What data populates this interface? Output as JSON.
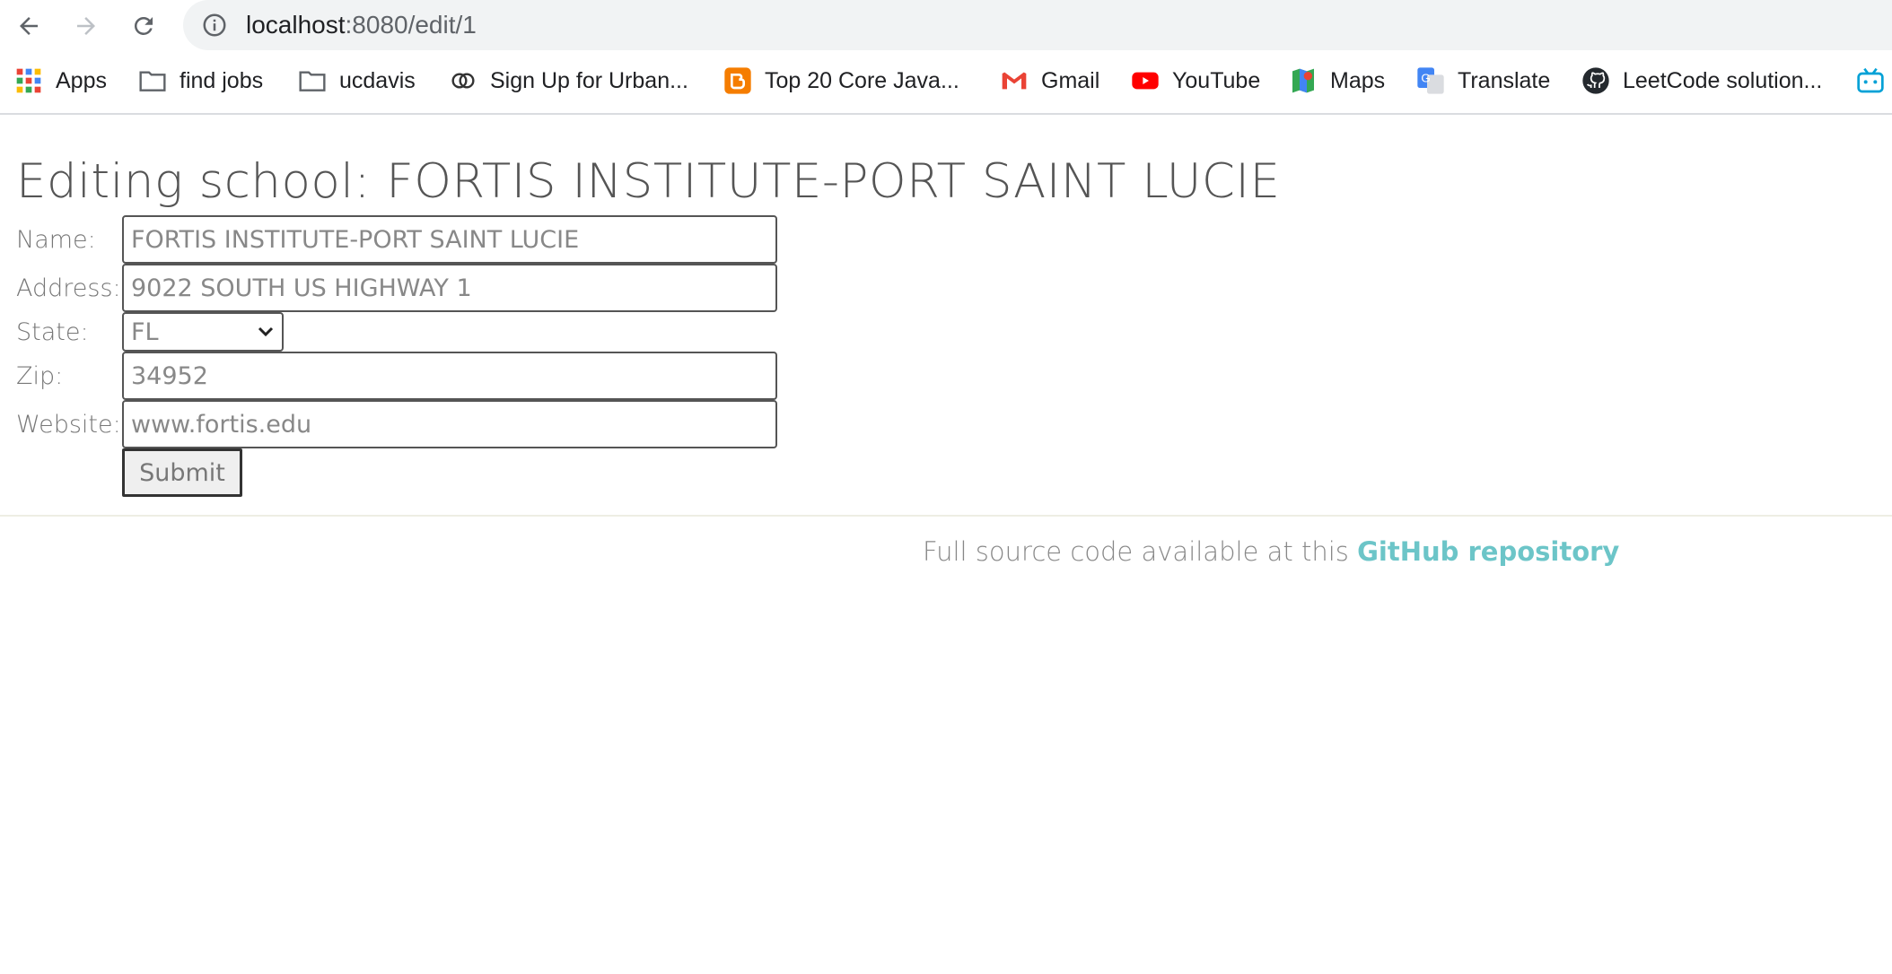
{
  "browser": {
    "url_host": "localhost",
    "url_path": ":8080/edit/1",
    "bookmarks": [
      {
        "label": "Apps",
        "icon": "apps-grid-icon"
      },
      {
        "label": "find jobs",
        "icon": "folder-icon"
      },
      {
        "label": "ucdavis",
        "icon": "folder-icon"
      },
      {
        "label": "Sign Up for Urban...",
        "icon": "rings-icon"
      },
      {
        "label": "Top 20 Core Java...",
        "icon": "blogger-icon"
      },
      {
        "label": "Gmail",
        "icon": "gmail-icon"
      },
      {
        "label": "YouTube",
        "icon": "youtube-icon"
      },
      {
        "label": "Maps",
        "icon": "maps-icon"
      },
      {
        "label": "Translate",
        "icon": "translate-icon"
      },
      {
        "label": "LeetCode solution...",
        "icon": "github-icon"
      },
      {
        "label": "",
        "icon": "bilibili-icon"
      }
    ]
  },
  "page": {
    "title": "Editing school: FORTIS INSTITUTE-PORT SAINT LUCIE",
    "form": {
      "name_label": "Name:",
      "name_value": "FORTIS INSTITUTE-PORT SAINT LUCIE",
      "address_label": "Address:",
      "address_value": "9022 SOUTH US HIGHWAY 1",
      "state_label": "State:",
      "state_value": "FL",
      "zip_label": "Zip:",
      "zip_value": "34952",
      "website_label": "Website:",
      "website_value": "www.fortis.edu",
      "submit_label": "Submit"
    },
    "footer": {
      "text": "Full source code available at this ",
      "link_text": "GitHub repository"
    }
  },
  "colors": {
    "link": "#6cc5c8",
    "label": "#777777",
    "input_text": "#888888"
  }
}
